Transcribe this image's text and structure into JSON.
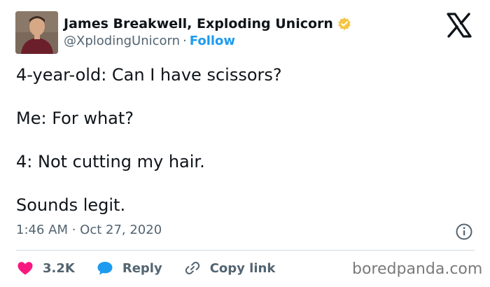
{
  "author": {
    "name": "James Breakwell, Exploding Unicorn",
    "handle": "@XplodingUnicorn",
    "follow_label": "Follow",
    "verified_color": "#f4c542"
  },
  "post": {
    "lines": [
      "4-year-old: Can I have scissors?",
      "Me: For what?",
      "4: Not cutting my hair.",
      "Sounds legit."
    ],
    "timestamp": "1:46 AM · Oct 27, 2020"
  },
  "actions": {
    "likes_count": "3.2K",
    "reply_label": "Reply",
    "copy_link_label": "Copy link"
  },
  "watermark": "boredpanda.com",
  "colors": {
    "accent": "#1d9bf0",
    "like": "#f91880",
    "muted": "#536471",
    "text": "#0f1419"
  },
  "icons": [
    "x-logo-icon",
    "verified-badge-icon",
    "info-icon",
    "heart-icon",
    "reply-bubble-icon",
    "link-icon"
  ]
}
